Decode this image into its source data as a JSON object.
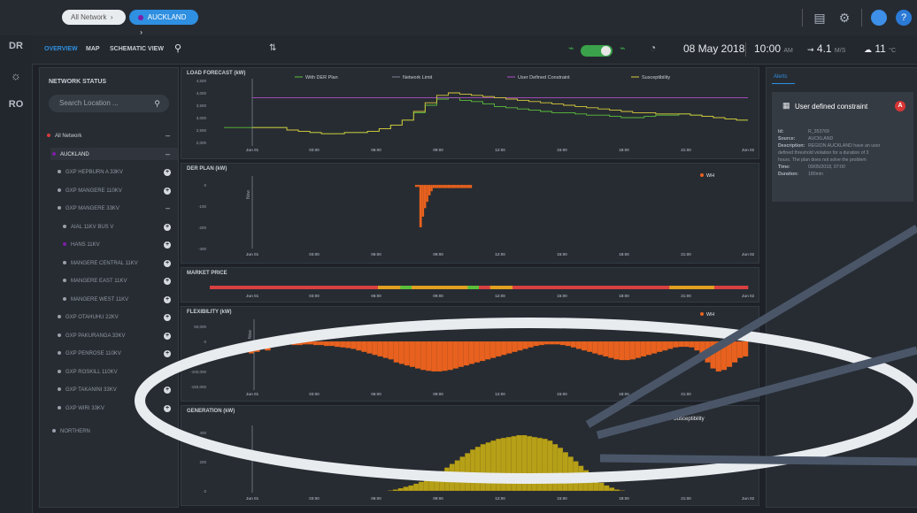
{
  "breadcrumb": {
    "root": "All Network",
    "current": "AUCKLAND"
  },
  "rail": {
    "items": [
      "DR",
      "RO"
    ]
  },
  "nav": {
    "tabs": [
      "OVERVIEW",
      "MAP",
      "SCHEMATIC VIEW"
    ]
  },
  "status": {
    "date": "08 May 2018",
    "time": "10:00",
    "ampm": "AM",
    "wind_value": "4.1",
    "wind_unit": "M/S",
    "temp_value": "11",
    "temp_unit": "°C"
  },
  "network_status": {
    "title": "NETWORK STATUS",
    "search_placeholder": "Search Location ...",
    "items": [
      {
        "label": "All Network",
        "level": 0,
        "marker": "red",
        "control": "minus"
      },
      {
        "label": "AUCKLAND",
        "level": 1,
        "marker": "purple",
        "control": "minus"
      },
      {
        "label": "GXP HEPBURN A 33KV",
        "level": 2,
        "marker": "grey",
        "control": "plus"
      },
      {
        "label": "GXP MANGERE 110KV",
        "level": 2,
        "marker": "grey",
        "control": "plus"
      },
      {
        "label": "GXP MANGERE 33KV",
        "level": 2,
        "marker": "grey",
        "control": "minus"
      },
      {
        "label": "AIAL 11KV BUS V",
        "level": 3,
        "marker": "grey",
        "control": "plus"
      },
      {
        "label": "HANS 11KV",
        "level": 3,
        "marker": "purple",
        "control": "plus"
      },
      {
        "label": "MANGERE CENTRAL 11KV",
        "level": 3,
        "marker": "grey",
        "control": "plus"
      },
      {
        "label": "MANGERE EAST 11KV",
        "level": 3,
        "marker": "grey",
        "control": "plus"
      },
      {
        "label": "MANGERE WEST 11KV",
        "level": 3,
        "marker": "grey",
        "control": "plus"
      },
      {
        "label": "GXP OTAHUHU 22KV",
        "level": 2,
        "marker": "grey",
        "control": "plus"
      },
      {
        "label": "GXP PAKURANGA 33KV",
        "level": 2,
        "marker": "grey",
        "control": "plus"
      },
      {
        "label": "GXP PENROSE 110KV",
        "level": 2,
        "marker": "grey",
        "control": "plus"
      },
      {
        "label": "GXP ROSKILL 110KV",
        "level": 2,
        "marker": "grey",
        "control": "plus"
      },
      {
        "label": "GXP TAKANINI 33KV",
        "level": 2,
        "marker": "grey",
        "control": "plus"
      },
      {
        "label": "GXP WIRI 33KV",
        "level": 2,
        "marker": "grey",
        "control": "plus"
      },
      {
        "label": "NORTHERN",
        "level": 1,
        "marker": "grey",
        "control": "plus"
      }
    ]
  },
  "time_axis": [
    "Jun 01",
    "03:00",
    "06:00",
    "09:00",
    "12:00",
    "15:00",
    "18:00",
    "21:00",
    "Jun 02"
  ],
  "colors": {
    "green": "#5bbf3a",
    "purple": "#b14fc5",
    "yellow": "#d7c93a",
    "orange": "#e8611f",
    "gold": "#b5a017",
    "red_band": "#d94040",
    "amber_band": "#e0a020"
  },
  "chart_data": [
    {
      "type": "line",
      "title": "LOAD FORECAST (kW)",
      "legend": [
        "With DER Plan",
        "Network Limit",
        "User Defined Constraint",
        "Susceptibility"
      ],
      "y_ticks": [
        "4,500",
        "4,000",
        "3,500",
        "3,000",
        "2,500",
        "2,000"
      ],
      "ylim": [
        2000,
        4500
      ],
      "series": [
        {
          "name": "With DER Plan",
          "color": "#5bbf3a",
          "values": [
            2600,
            2600,
            2600,
            2500,
            2450,
            2400,
            2350,
            2350,
            2400,
            2400,
            2450,
            2550,
            2700,
            2900,
            3200,
            3500,
            3750,
            3800,
            3700,
            3650,
            3550,
            3450,
            3400,
            3350,
            3300,
            3250,
            3200,
            3200,
            3150,
            3100,
            3100,
            3050,
            3000,
            3000,
            3050,
            3100,
            3100,
            3150,
            3100,
            3050,
            3000,
            2950,
            2900,
            2900
          ]
        },
        {
          "name": "User Defined Constraint",
          "color": "#b14fc5",
          "values": [
            3800,
            3800,
            3800,
            3800,
            3800,
            3800,
            3800,
            3800,
            3800,
            3800,
            3800,
            3800,
            3800,
            3800,
            3800,
            3800,
            3800,
            3800,
            3800,
            3800,
            3800,
            3800,
            3800,
            3800,
            3800,
            3800,
            3800,
            3800,
            3800,
            3800,
            3800,
            3800,
            3800,
            3800,
            3800,
            3800,
            3800,
            3800,
            3800,
            3800,
            3800,
            3800,
            3800,
            3800
          ]
        },
        {
          "name": "Susceptibility",
          "color": "#d7c93a",
          "values": [
            2600,
            2600,
            2600,
            2500,
            2450,
            2400,
            2350,
            2350,
            2400,
            2400,
            2450,
            2550,
            2700,
            2900,
            3250,
            3600,
            3900,
            4000,
            3950,
            3900,
            3850,
            3800,
            3750,
            3700,
            3650,
            3600,
            3550,
            3500,
            3450,
            3400,
            3350,
            3300,
            3250,
            3200,
            3200,
            3150,
            3150,
            3150,
            3100,
            3050,
            3000,
            2950,
            2900,
            2900
          ]
        }
      ]
    },
    {
      "type": "bar",
      "title": "DER PLAN (kW)",
      "legend": [
        "WH"
      ],
      "y_ticks": [
        "0",
        "-100",
        "-200",
        "-300"
      ],
      "ylim": [
        -300,
        0
      ],
      "now_label": "Now",
      "series": [
        {
          "name": "WH",
          "color": "#e8611f",
          "values": [
            0,
            0,
            0,
            0,
            0,
            0,
            0,
            0,
            0,
            0,
            0,
            0,
            0,
            0,
            0,
            0,
            0,
            0,
            0,
            0,
            0,
            0,
            0,
            0,
            0,
            0,
            0,
            0,
            0,
            0,
            0,
            0,
            0,
            0,
            0,
            0,
            0,
            0,
            0,
            0,
            0,
            0,
            0,
            0,
            0,
            0,
            0,
            0,
            0,
            0,
            0,
            0,
            0,
            0,
            0,
            0,
            0,
            0,
            0,
            0,
            0,
            0,
            0,
            0,
            0,
            0,
            0,
            0,
            0,
            0,
            0,
            0,
            0,
            0,
            -10,
            -10,
            -200,
            -150,
            -110,
            -80,
            -50,
            -30,
            -15,
            -15,
            -15,
            -15,
            -15,
            -15,
            -15,
            -15,
            -15,
            -15,
            -15,
            -15,
            -15,
            -15,
            -15,
            -15,
            -15,
            -15,
            0,
            0,
            0,
            0,
            0,
            0,
            0,
            0,
            0,
            0,
            0,
            0,
            0,
            0,
            0,
            0,
            0,
            0,
            0,
            0,
            0,
            0,
            0,
            0,
            0,
            0,
            0,
            0,
            0,
            0,
            0,
            0,
            0,
            0,
            0,
            0,
            0,
            0,
            0,
            0,
            0,
            0,
            0,
            0,
            0,
            0,
            0,
            0,
            0,
            0,
            0,
            0,
            0,
            0,
            0,
            0,
            0,
            0,
            0,
            0,
            0,
            0,
            0,
            0,
            0,
            0,
            0,
            0,
            0,
            0,
            0,
            0,
            0,
            0,
            0,
            0,
            0,
            0,
            0,
            0,
            0,
            0,
            0,
            0,
            0,
            0,
            0,
            0,
            0,
            0,
            0,
            0,
            0,
            0,
            0,
            0,
            0,
            0,
            0,
            0,
            0,
            0,
            0,
            0,
            0,
            0,
            0,
            0,
            0,
            0,
            0,
            0,
            0,
            0,
            0,
            0,
            0,
            0,
            0,
            0,
            0,
            0,
            0,
            0,
            0,
            0,
            0
          ]
        }
      ]
    },
    {
      "type": "heatmap",
      "title": "MARKET PRICE",
      "segments": [
        "red",
        "red",
        "red",
        "red",
        "red",
        "red",
        "red",
        "red",
        "red",
        "red",
        "red",
        "red",
        "red",
        "red",
        "red",
        "amber",
        "amber",
        "green",
        "amber",
        "amber",
        "amber",
        "amber",
        "amber",
        "green",
        "red",
        "amber",
        "amber",
        "red",
        "red",
        "red",
        "red",
        "red",
        "red",
        "red",
        "red",
        "red",
        "red",
        "red",
        "red",
        "red",
        "red",
        "amber",
        "amber",
        "amber",
        "amber",
        "red",
        "red",
        "red"
      ]
    },
    {
      "type": "bar",
      "title": "FLEXIBILITY (kW)",
      "legend": [
        "WH"
      ],
      "y_ticks": [
        "50,000",
        "0",
        "-50,000",
        "-100,000",
        "-150,000"
      ],
      "ylim": [
        -150000,
        50000
      ],
      "now_label": "Now",
      "series": [
        {
          "name": "WH",
          "color": "#e8611f",
          "values": [
            -40000,
            -35000,
            -20000,
            -30000,
            -15000,
            -12000,
            -10000,
            -10000,
            -12000,
            -12000,
            -10000,
            -10000,
            -12000,
            -12000,
            -15000,
            -15000,
            -18000,
            -20000,
            -22000,
            -25000,
            -30000,
            -35000,
            -40000,
            -45000,
            -50000,
            -55000,
            -60000,
            -70000,
            -75000,
            -80000,
            -85000,
            -90000,
            -95000,
            -98000,
            -100000,
            -100000,
            -98000,
            -95000,
            -90000,
            -85000,
            -80000,
            -75000,
            -70000,
            -65000,
            -60000,
            -55000,
            -50000,
            -45000,
            -40000,
            -35000,
            -30000,
            -25000,
            -20000,
            -15000,
            -12000,
            -10000,
            -10000,
            -10000,
            -12000,
            -15000,
            -20000,
            -25000,
            -30000,
            -35000,
            -40000,
            -45000,
            -50000,
            -55000,
            -60000,
            -62000,
            -62000,
            -60000,
            -55000,
            -50000,
            -45000,
            -40000,
            -35000,
            -30000,
            -25000,
            -20000,
            -18000,
            -18000,
            -20000,
            -30000,
            -50000,
            -70000,
            -90000,
            -100000,
            -95000,
            -85000,
            -70000,
            -55000,
            -50000
          ]
        }
      ]
    },
    {
      "type": "bar",
      "title": "GENERATION (kW)",
      "legend": [
        "PV Susceptibility"
      ],
      "y_ticks": [
        "400",
        "200",
        "0"
      ],
      "ylim": [
        0,
        650
      ],
      "series": [
        {
          "name": "PV Susceptibility",
          "color": "#b5a017",
          "values": [
            0,
            0,
            0,
            0,
            0,
            0,
            0,
            0,
            0,
            0,
            0,
            0,
            0,
            0,
            0,
            0,
            0,
            0,
            0,
            0,
            0,
            0,
            0,
            0,
            0,
            0,
            5,
            15,
            30,
            45,
            60,
            80,
            100,
            130,
            160,
            190,
            220,
            260,
            300,
            340,
            380,
            420,
            460,
            490,
            520,
            540,
            560,
            580,
            590,
            600,
            610,
            620,
            620,
            610,
            600,
            590,
            580,
            560,
            520,
            480,
            430,
            380,
            330,
            280,
            230,
            180,
            130,
            90,
            60,
            35,
            15,
            5,
            0,
            0,
            0,
            0,
            0,
            0,
            0,
            0,
            0,
            0,
            0,
            0,
            0,
            0,
            0,
            0,
            0,
            0,
            0,
            0,
            0,
            0,
            0,
            0
          ]
        }
      ]
    }
  ],
  "alerts": {
    "tab": "Alerts",
    "card_title": "User defined constraint",
    "badge": "A",
    "id_label": "Id:",
    "id_value": "R_353769",
    "source_label": "Source:",
    "source_value": "AUCKLAND",
    "description_label": "Description:",
    "description_lines": [
      "REGION AUCKLAND have an user",
      "defined threshold violation for a duration of 3",
      "hours. The plan does not solve the problem"
    ],
    "time_label": "Time:",
    "time_value": "09/05/2018, 07:00",
    "duration_label": "Duration:",
    "duration_value": "180min"
  }
}
